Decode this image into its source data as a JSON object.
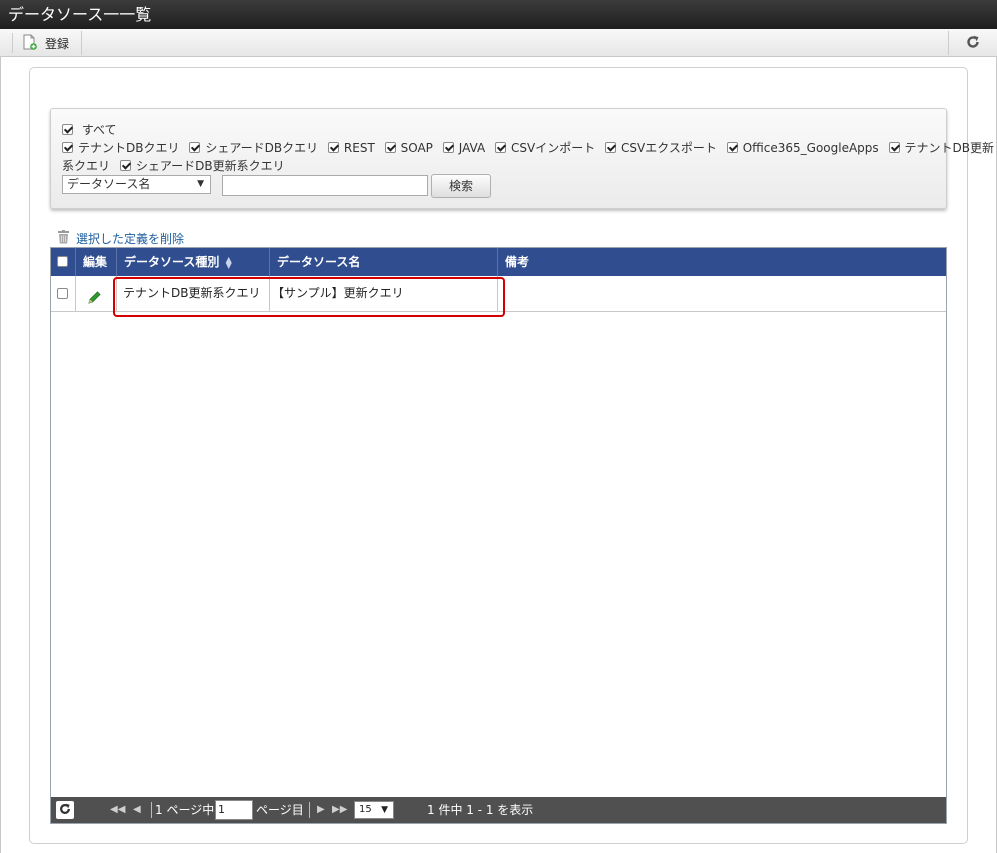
{
  "window": {
    "title": "データソース一一覧"
  },
  "toolbar": {
    "register_label": "登録"
  },
  "search": {
    "all_label": "すべて",
    "types_line1": [
      "テナントDBクエリ",
      "シェアードDBクエリ",
      "REST",
      "SOAP",
      "JAVA",
      "CSVインポート",
      "CSVエクスポート",
      "Office365_GoogleApps",
      "テナントDB更新"
    ],
    "types_line2_lead": "系クエリ",
    "types_line2": [
      "シェアードDB更新系クエリ"
    ],
    "field_select": "データソース名",
    "keyword_value": "",
    "search_button": "検索"
  },
  "actions": {
    "delete_selected": "選択した定義を削除"
  },
  "grid": {
    "columns": {
      "edit": "編集",
      "type": "データソース種別",
      "name": "データソース名",
      "note": "備考"
    },
    "rows": [
      {
        "type": "テナントDB更新系クエリ",
        "name": "【サンプル】更新クエリ",
        "note": ""
      }
    ]
  },
  "pager": {
    "page_prefix": "1 ページ中",
    "page_value": "1",
    "page_suffix": "ページ目",
    "per_page": "15",
    "summary": "1 件中 1 - 1 を表示"
  },
  "colors": {
    "accent": "#2f4d8f",
    "highlight": "#d40000",
    "link": "#1f5fa0"
  }
}
